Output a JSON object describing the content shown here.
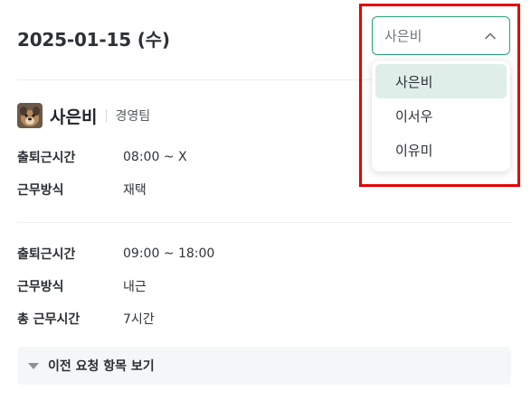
{
  "header": {
    "date": "2025-01-15 (수)"
  },
  "user": {
    "name": "사은비",
    "team": "경영팀",
    "avatar_icon": "dog-photo-avatar"
  },
  "record1": {
    "rows": [
      {
        "label": "출퇴근시간",
        "value": "08:00 ~ X"
      },
      {
        "label": "근무방식",
        "value": "재택"
      }
    ]
  },
  "record2": {
    "rows": [
      {
        "label": "출퇴근시간",
        "value": "09:00 ~ 18:00"
      },
      {
        "label": "근무방식",
        "value": "내근"
      },
      {
        "label": "총 근무시간",
        "value": "7시간"
      }
    ]
  },
  "prev_requests": {
    "label": "이전 요청 항목 보기",
    "icon": "caret-down-icon"
  },
  "select": {
    "value": "사은비",
    "icon": "chevron-up-icon",
    "options": [
      "사은비",
      "이서우",
      "이유미"
    ],
    "selected_index": 0
  },
  "colors": {
    "accent": "#25a27a",
    "selected_bg": "#dfeee9",
    "highlight": "#e60000"
  }
}
